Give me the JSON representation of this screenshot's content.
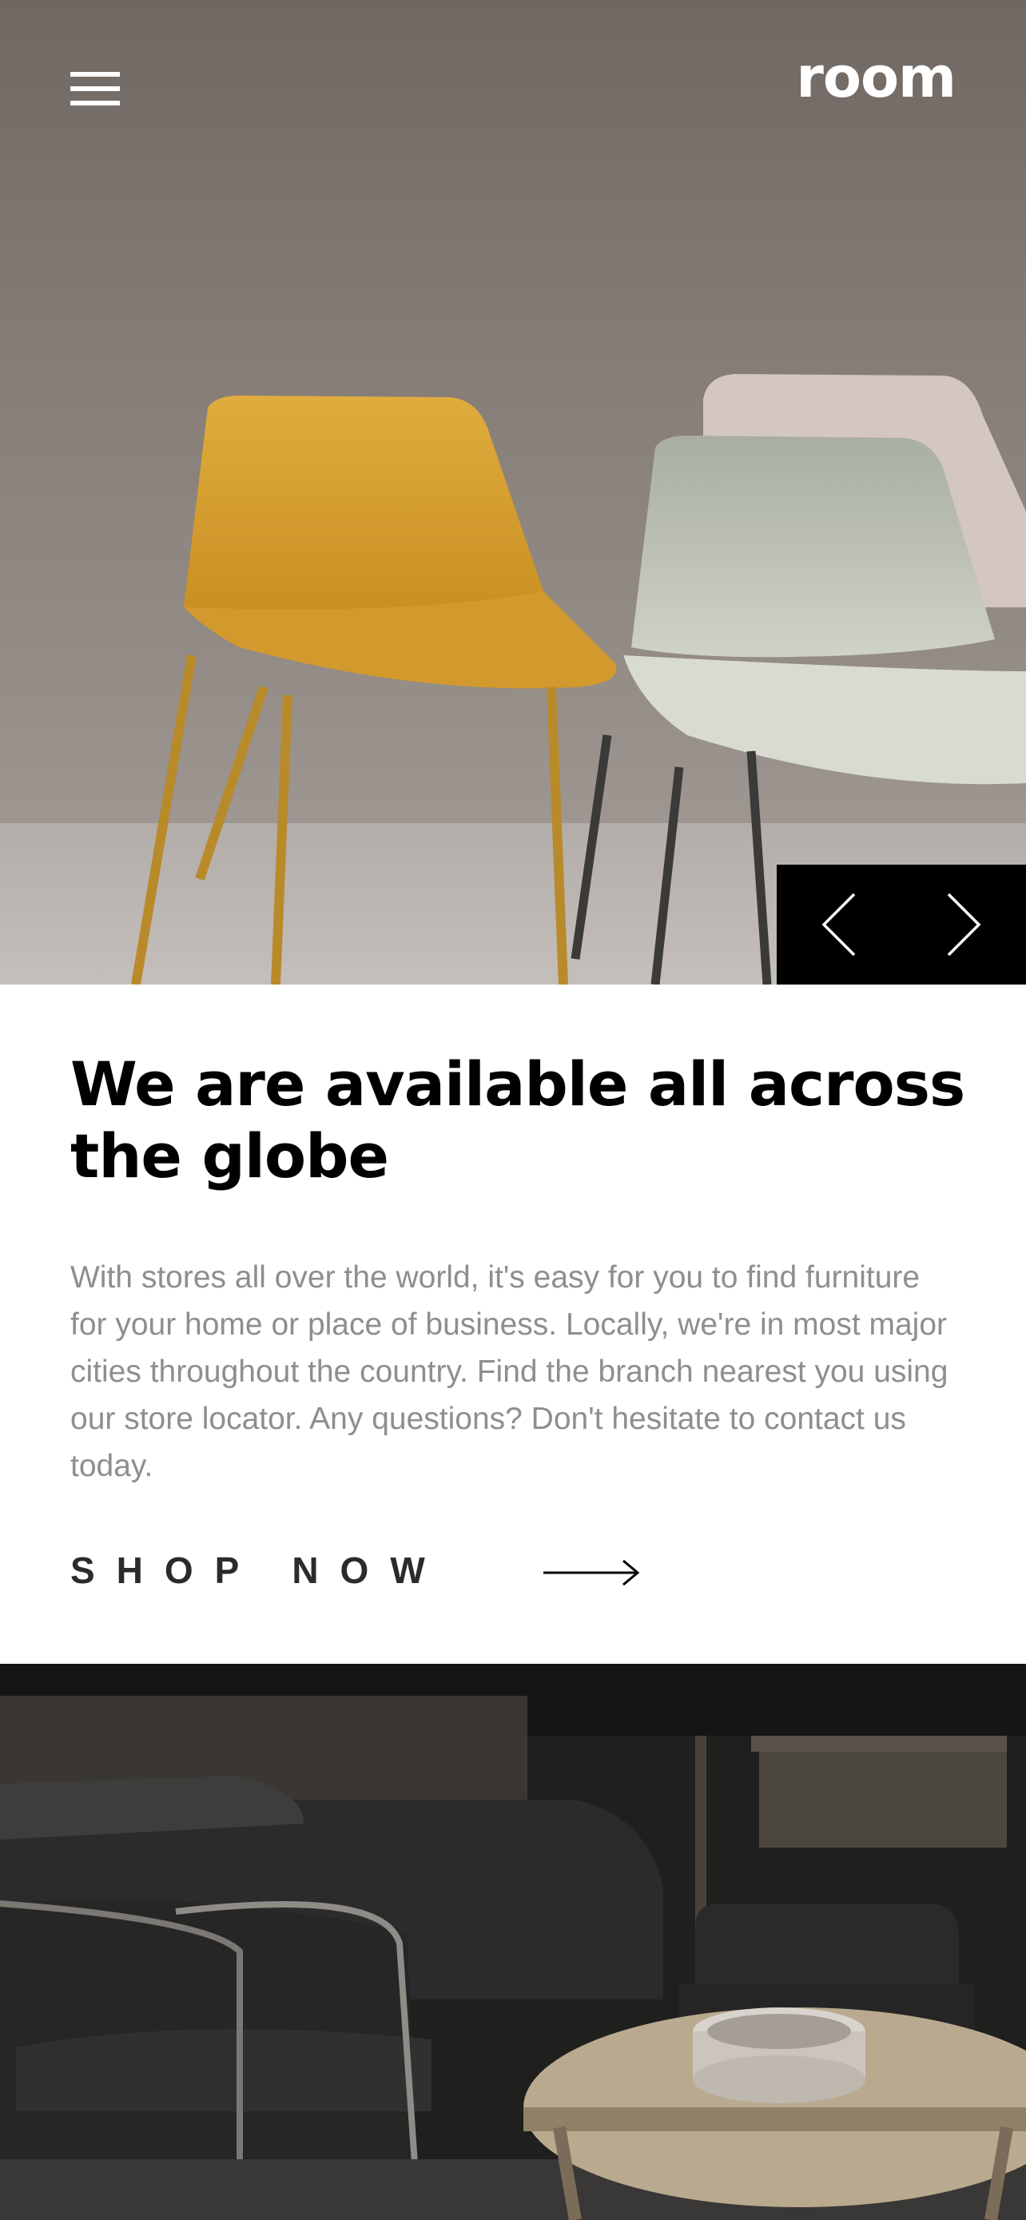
{
  "header": {
    "brand": "room",
    "menu_icon": "hamburger-menu-icon"
  },
  "hero": {
    "image": "yellow-and-sage-chairs-photo",
    "controls": {
      "prev_icon": "chevron-left-icon",
      "next_icon": "chevron-right-icon"
    }
  },
  "about": {
    "title": "We are available all across the globe",
    "body": "With stores all over the world, it's easy for you to find furniture for your home or place of business. Locally, we're in most major cities throughout the country. Find the branch nearest you using our store locator. Any questions? Don't hesitate to contact us today.",
    "cta_label": "SHOP NOW",
    "cta_icon": "arrow-right-icon"
  },
  "gallery": {
    "image": "dark-living-room-photo"
  },
  "colors": {
    "text_primary": "#000000",
    "text_body": "#8e8e8e",
    "cta_text": "#2b2b2b",
    "controls_bg": "#000000"
  }
}
